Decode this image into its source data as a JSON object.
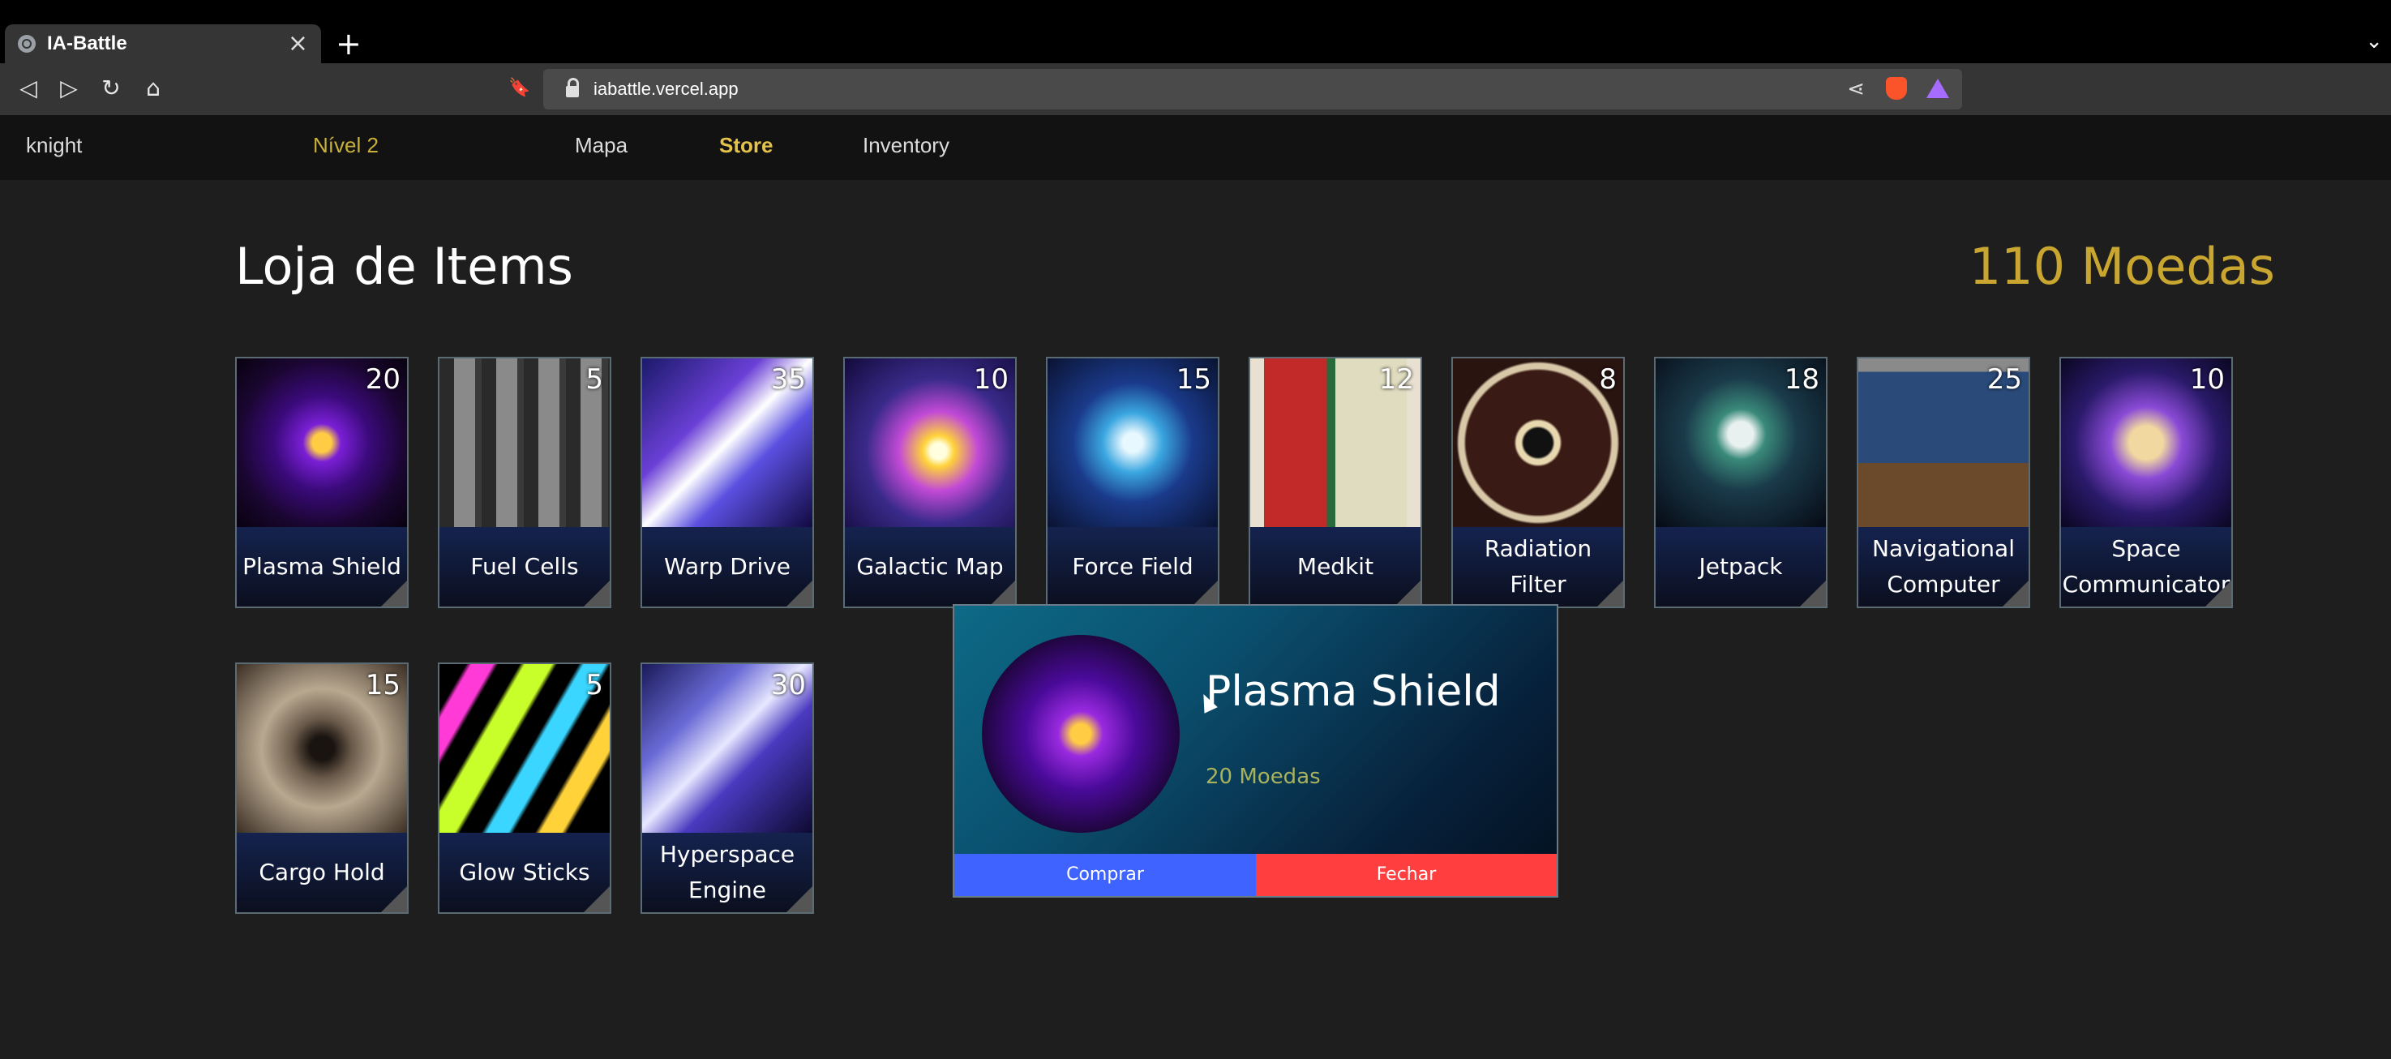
{
  "browser": {
    "tab_title": "IA-Battle",
    "tab_close": "×",
    "new_tab": "+",
    "tabs_menu": "⌄",
    "url": "iabattle.vercel.app",
    "back": "◁",
    "forward": "▷",
    "reload": "↻",
    "home": "⌂",
    "bookmark": "🔖",
    "share": "⋖"
  },
  "nav": {
    "user": "knight",
    "level": "Nível 2",
    "map": "Mapa",
    "store": "Store",
    "inventory": "Inventory"
  },
  "store": {
    "title": "Loja de Items",
    "coins": "110 Moedas",
    "items": [
      {
        "name": "Plasma Shield",
        "price": "20"
      },
      {
        "name": "Fuel Cells",
        "price": "5"
      },
      {
        "name": "Warp Drive",
        "price": "35"
      },
      {
        "name": "Galactic Map",
        "price": "10"
      },
      {
        "name": "Force Field",
        "price": "15"
      },
      {
        "name": "Medkit",
        "price": "12"
      },
      {
        "name": "Radiation Filter",
        "price": "8"
      },
      {
        "name": "Jetpack",
        "price": "18"
      },
      {
        "name": "Navigational Computer",
        "price": "25"
      },
      {
        "name": "Space Communicator",
        "price": "10"
      },
      {
        "name": "Cargo Hold",
        "price": "15"
      },
      {
        "name": "Glow Sticks",
        "price": "5"
      },
      {
        "name": "Hyperspace Engine",
        "price": "30"
      }
    ]
  },
  "modal": {
    "title": "Plasma Shield",
    "price": "20 Moedas",
    "buy": "Comprar",
    "close": "Fechar"
  },
  "colors": {
    "accent_gold": "#c9a62f",
    "buy_blue": "#3e63ff",
    "close_red": "#ff3f3f"
  }
}
